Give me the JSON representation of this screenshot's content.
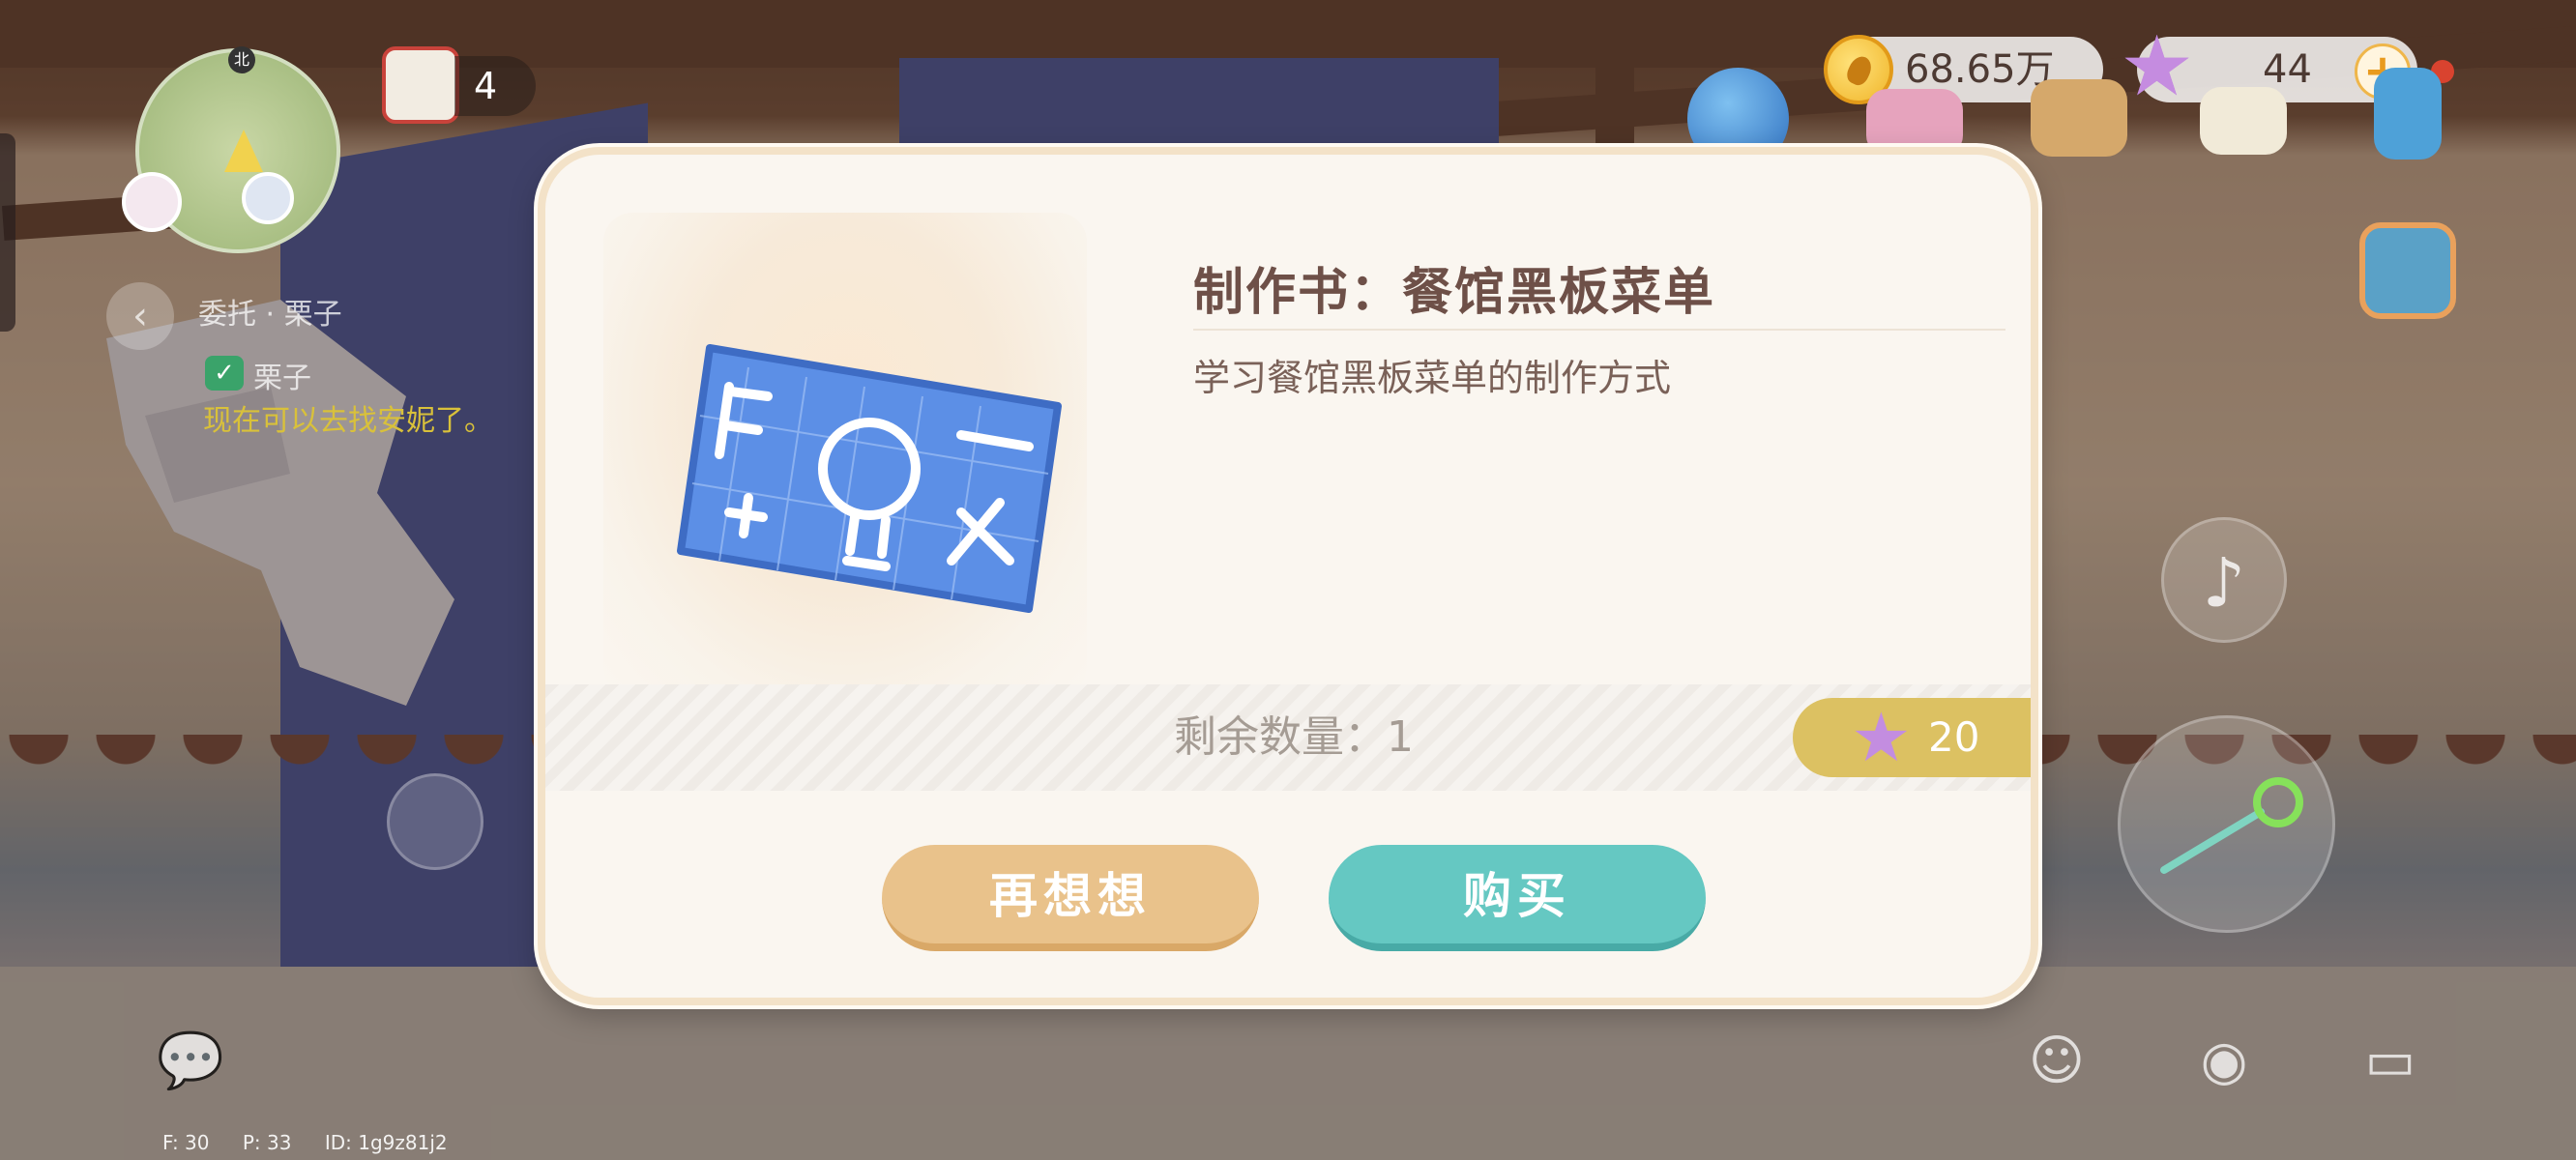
{
  "hud": {
    "minimap": {
      "north_label": "北"
    },
    "calendar": {
      "count": "4",
      "icon": "calendar-icon"
    },
    "quest": {
      "title": "委托 · 栗子",
      "sub": "栗子",
      "message": "现在可以去找安妮了。"
    },
    "currency": {
      "coins": "68.65万",
      "stars": "44",
      "plus": "+"
    },
    "debug": {
      "fps": "F: 30",
      "ping": "P: 33",
      "id": "ID: 1g9z81j2"
    }
  },
  "dialog": {
    "item_name": "制作书：餐馆黑板菜单",
    "item_description": "学习餐馆黑板菜单的制作方式",
    "stock_label": "剩余数量：1",
    "price": "20",
    "cancel_label": "再想想",
    "buy_label": "购买"
  },
  "colors": {
    "accent_buy": "#65c8c2",
    "accent_cancel": "#e9c28b",
    "price_tag": "#dcc162",
    "title_text": "#6e5048"
  }
}
